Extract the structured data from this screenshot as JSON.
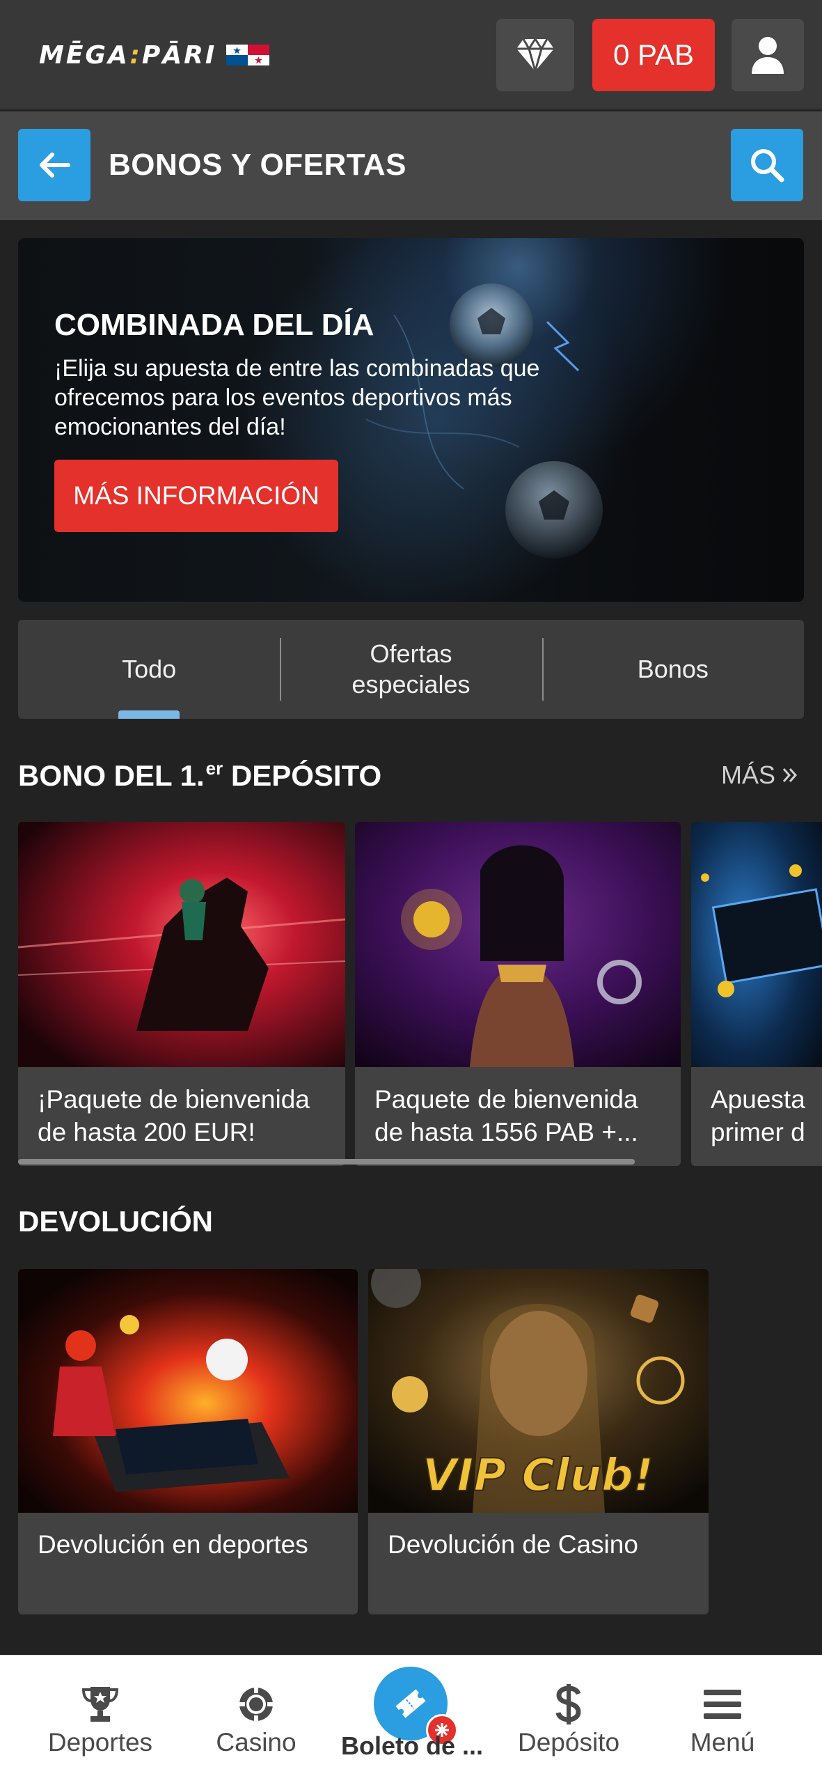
{
  "header": {
    "logo": {
      "left": "MĒGA",
      "sep": ":",
      "right": "PĀRI"
    },
    "flag_name": "panama-flag-icon",
    "balance_label": "0 PAB",
    "icons": {
      "vip": "diamond-icon",
      "account": "user-icon"
    }
  },
  "subheader": {
    "title": "BONOS Y OFERTAS",
    "icons": {
      "back": "arrow-left-icon",
      "search": "search-icon"
    }
  },
  "hero": {
    "title": "COMBINADA DEL DÍA",
    "text": "¡Elija su apuesta de entre las combinadas que ofrecemos para los eventos deportivos más emocionantes del día!",
    "button_label": "MÁS INFORMACIÓN"
  },
  "tabs": [
    {
      "label": "Todo",
      "active": true
    },
    {
      "label": "Ofertas especiales",
      "active": false
    },
    {
      "label": "Bonos",
      "active": false
    }
  ],
  "first_deposit": {
    "title_before": "BONO DEL 1.",
    "title_sup": "er",
    "title_after": " DEPÓSITO",
    "more_label": "MÁS",
    "cards": [
      {
        "line1": "¡Paquete de bienvenida",
        "line2": "de hasta 200 EUR!"
      },
      {
        "line1": "Paquete de bienvenida",
        "line2": "de hasta 1556 PAB +..."
      },
      {
        "line1": "Apuesta",
        "line2": "primer d"
      }
    ]
  },
  "refund": {
    "title": "DEVOLUCIÓN",
    "cards": [
      {
        "label": "Devolución en deportes"
      },
      {
        "label": "Devolución de Casino",
        "image_text": "VIP Club!"
      }
    ]
  },
  "bottom_nav": [
    {
      "label": "Deportes",
      "icon": "trophy-icon"
    },
    {
      "label": "Casino",
      "icon": "casino-chip-icon"
    },
    {
      "label": "Boleto de ...",
      "icon": "ticket-icon"
    },
    {
      "label": "Depósito",
      "icon": "dollar-icon"
    },
    {
      "label": "Menú",
      "icon": "hamburger-menu-icon"
    }
  ],
  "colors": {
    "accent_red": "#e4312b",
    "accent_blue": "#2a9ee0",
    "header_bg": "#383838",
    "page_bg": "#222222",
    "card_bg": "#424242"
  }
}
